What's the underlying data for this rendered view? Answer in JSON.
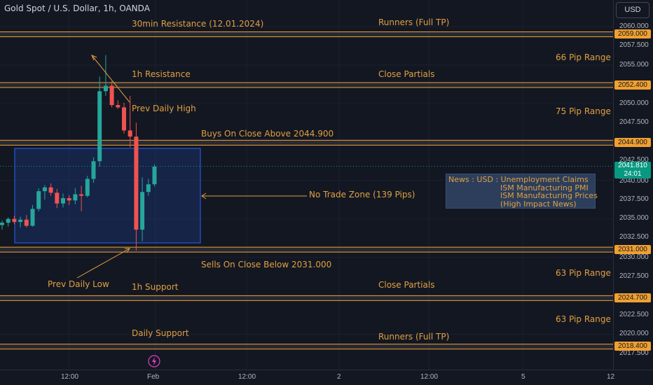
{
  "header": {
    "title": "Gold Spot / U.S. Dollar, 1h, OANDA",
    "currency": "USD"
  },
  "price_axis": {
    "ticks": [
      "2060.000",
      "2057.500",
      "2055.000",
      "2050.000",
      "2047.500",
      "2042.500",
      "2040.000",
      "2037.500",
      "2035.000",
      "2032.500",
      "2030.000",
      "2027.500",
      "2022.500",
      "2020.000",
      "2017.500"
    ],
    "levels": [
      "2059.000",
      "2052.400",
      "2044.900",
      "2031.000",
      "2024.700",
      "2018.400"
    ],
    "current_price": "2041.810",
    "countdown": "24:01"
  },
  "time_axis": {
    "labels": [
      "12:00",
      "Feb",
      "12:00",
      "2",
      "12:00",
      "5",
      "12"
    ]
  },
  "annotations": {
    "resistance_30min": "30min Resistance (12.01.2024)",
    "runners_top": "Runners (Full TP)",
    "range_66": "66 Pip Range",
    "resistance_1h": "1h Resistance",
    "close_partials_top": "Close Partials",
    "prev_daily_high": "Prev Daily High",
    "range_75": "75 Pip Range",
    "buys": "Buys On Close Above 2044.900",
    "no_trade": "No Trade Zone (139 Pips)",
    "sells": "Sells On Close Below 2031.000",
    "range_63_a": "63 Pip Range",
    "prev_daily_low": "Prev Daily Low",
    "support_1h": "1h Support",
    "close_partials_bottom": "Close Partials",
    "range_63_b": "63 Pip Range",
    "daily_support": "Daily Support",
    "runners_bottom": "Runners (Full TP)"
  },
  "news": {
    "lines": [
      "News : USD : Unemployment Claims",
      "ISM Manufacturing PMI",
      "ISM Manufacturing Prices",
      "(High Impact News)"
    ]
  },
  "colors": {
    "background": "#131722",
    "bullish": "#26a69a",
    "bearish": "#ef5350",
    "level_line": "#f0a030",
    "annotation": "#e0a040",
    "zone": "#2962ff"
  },
  "icons": {
    "lightning": "lightning-icon"
  },
  "chart_data": {
    "type": "candlestick",
    "title": "Gold Spot / U.S. Dollar, 1h, OANDA",
    "y_range": [
      2016,
      2062
    ],
    "horizontal_levels": [
      2059.0,
      2052.4,
      2044.9,
      2031.0,
      2024.7,
      2018.4
    ],
    "no_trade_zone": {
      "high": 2044.9,
      "low": 2031.0
    },
    "candles": [
      {
        "o": 2034.2,
        "h": 2034.8,
        "l": 2033.6,
        "c": 2034.5
      },
      {
        "o": 2034.5,
        "h": 2035.2,
        "l": 2034.0,
        "c": 2035.0
      },
      {
        "o": 2035.0,
        "h": 2035.4,
        "l": 2034.3,
        "c": 2034.6
      },
      {
        "o": 2034.6,
        "h": 2035.3,
        "l": 2033.9,
        "c": 2034.9
      },
      {
        "o": 2034.9,
        "h": 2035.5,
        "l": 2033.9,
        "c": 2034.1
      },
      {
        "o": 2034.1,
        "h": 2036.8,
        "l": 2034.0,
        "c": 2036.3
      },
      {
        "o": 2036.3,
        "h": 2039.0,
        "l": 2036.0,
        "c": 2038.6
      },
      {
        "o": 2038.6,
        "h": 2039.4,
        "l": 2037.5,
        "c": 2039.1
      },
      {
        "o": 2039.1,
        "h": 2039.6,
        "l": 2038.0,
        "c": 2038.4
      },
      {
        "o": 2038.4,
        "h": 2038.9,
        "l": 2036.4,
        "c": 2037.0
      },
      {
        "o": 2037.0,
        "h": 2038.3,
        "l": 2036.5,
        "c": 2037.7
      },
      {
        "o": 2037.7,
        "h": 2038.1,
        "l": 2036.8,
        "c": 2037.4
      },
      {
        "o": 2037.4,
        "h": 2039.0,
        "l": 2036.9,
        "c": 2038.2
      },
      {
        "o": 2038.2,
        "h": 2039.3,
        "l": 2036.0,
        "c": 2038.0
      },
      {
        "o": 2038.0,
        "h": 2040.6,
        "l": 2037.8,
        "c": 2040.2
      },
      {
        "o": 2040.2,
        "h": 2043.0,
        "l": 2039.7,
        "c": 2042.5
      },
      {
        "o": 2042.5,
        "h": 2053.5,
        "l": 2041.8,
        "c": 2051.6
      },
      {
        "o": 2051.6,
        "h": 2056.3,
        "l": 2051.0,
        "c": 2052.3
      },
      {
        "o": 2052.3,
        "h": 2052.9,
        "l": 2049.5,
        "c": 2049.8
      },
      {
        "o": 2049.8,
        "h": 2050.4,
        "l": 2049.3,
        "c": 2049.5
      },
      {
        "o": 2049.5,
        "h": 2050.1,
        "l": 2046.1,
        "c": 2046.5
      },
      {
        "o": 2046.5,
        "h": 2051.0,
        "l": 2044.3,
        "c": 2045.7
      },
      {
        "o": 2045.7,
        "h": 2047.5,
        "l": 2030.9,
        "c": 2033.6
      },
      {
        "o": 2033.6,
        "h": 2040.4,
        "l": 2032.1,
        "c": 2038.5
      },
      {
        "o": 2038.5,
        "h": 2040.2,
        "l": 2038.0,
        "c": 2039.5
      },
      {
        "o": 2039.5,
        "h": 2042.1,
        "l": 2039.2,
        "c": 2041.81
      }
    ]
  }
}
